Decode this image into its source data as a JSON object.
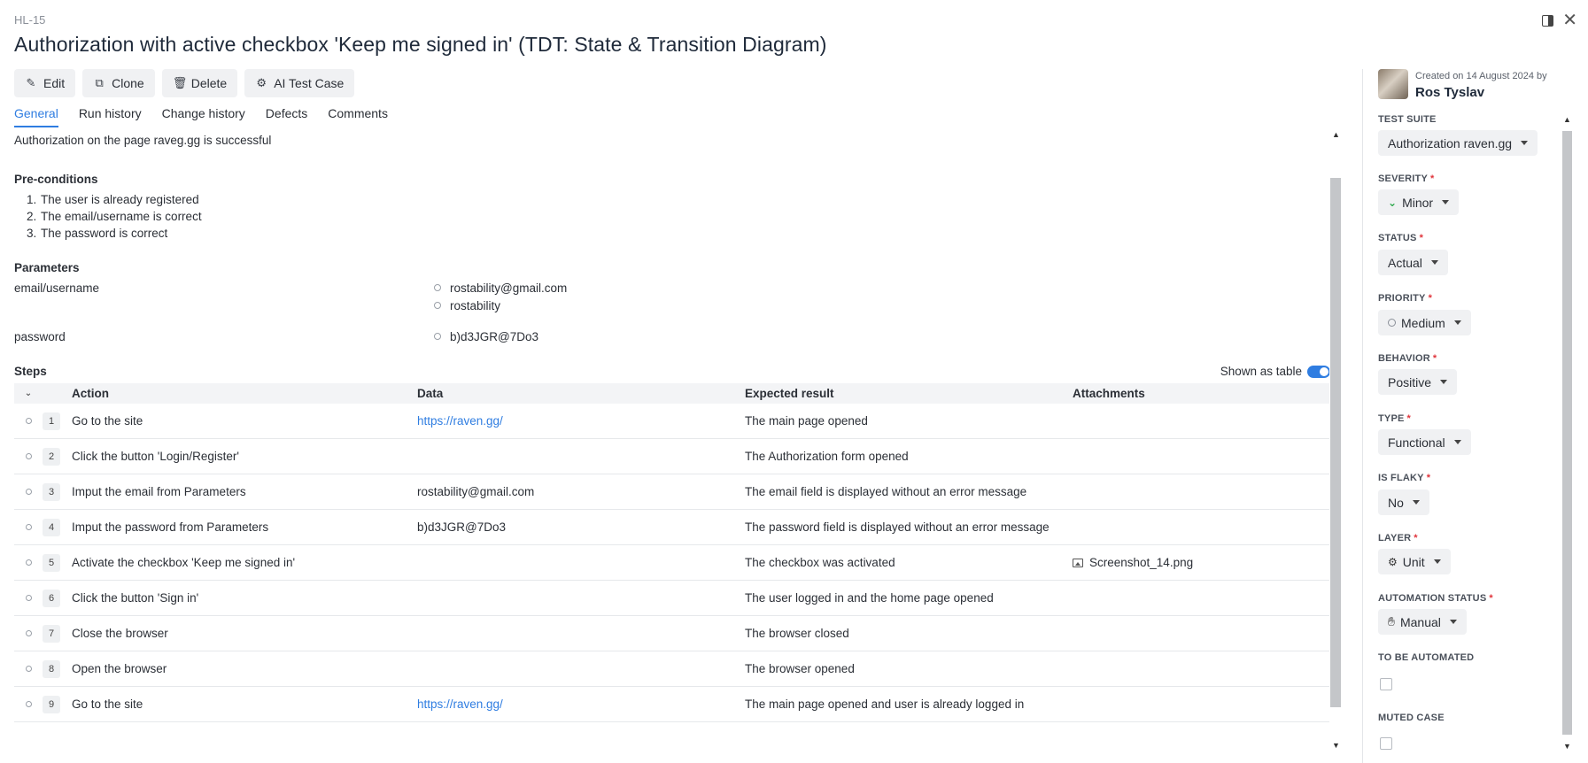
{
  "header": {
    "case_id": "HL-15",
    "title": "Authorization with active checkbox 'Keep me signed in' (TDT: State & Transition Diagram)"
  },
  "toolbar": {
    "edit": "Edit",
    "clone": "Clone",
    "delete": "Delete",
    "ai": "AI Test Case"
  },
  "tabs": [
    "General",
    "Run history",
    "Change history",
    "Defects",
    "Comments"
  ],
  "general": {
    "description": "Authorization on the page raveg.gg is successful",
    "preconditions_title": "Pre-conditions",
    "preconditions": [
      {
        "num": "1.",
        "text": "The user is already registered"
      },
      {
        "num": "2.",
        "text": "The email/username is correct"
      },
      {
        "num": "3.",
        "text": "The password is correct"
      }
    ],
    "parameters_title": "Parameters",
    "parameters": [
      {
        "name": "email/username",
        "values": [
          "rostability@gmail.com",
          "rostability"
        ]
      },
      {
        "name": "password",
        "values": [
          "b)d3JGR@7Do3"
        ]
      }
    ],
    "steps_title": "Steps",
    "shown_as_table": "Shown as table"
  },
  "steps_table": {
    "headers": {
      "action": "Action",
      "data": "Data",
      "expected": "Expected result",
      "attachments": "Attachments"
    },
    "rows": [
      {
        "num": "1",
        "action": "Go to the site",
        "data": "https://raven.gg/",
        "expected": "The main page opened",
        "attachment": ""
      },
      {
        "num": "2",
        "action": "Click the button 'Login/Register'",
        "data": "",
        "expected": "The Authorization form opened",
        "attachment": ""
      },
      {
        "num": "3",
        "action": "Imput the email from Parameters",
        "data": "rostability@gmail.com",
        "expected": "The email field is displayed without an error message",
        "attachment": ""
      },
      {
        "num": "4",
        "action": "Imput the password from Parameters",
        "data": "b)d3JGR@7Do3",
        "expected": "The password field is displayed without an error message",
        "attachment": ""
      },
      {
        "num": "5",
        "action": "Activate the checkbox 'Keep me signed in'",
        "data": "",
        "expected": "The checkbox was activated",
        "attachment": "Screenshot_14.png"
      },
      {
        "num": "6",
        "action": "Click the button 'Sign in'",
        "data": "",
        "expected": "The user logged in and the home page opened",
        "attachment": ""
      },
      {
        "num": "7",
        "action": "Close the browser",
        "data": "",
        "expected": "The browser closed",
        "attachment": ""
      },
      {
        "num": "8",
        "action": "Open the browser",
        "data": "",
        "expected": "The browser opened",
        "attachment": ""
      },
      {
        "num": "9",
        "action": "Go to the site",
        "data": "https://raven.gg/",
        "expected": "The main page opened and user is already logged in",
        "attachment": ""
      }
    ]
  },
  "sidebar": {
    "created": "Created on 14 August 2024 by",
    "author": "Ros Tyslav",
    "fields": {
      "test_suite": {
        "label": "TEST SUITE",
        "value": "Authorization raven.gg"
      },
      "severity": {
        "label": "SEVERITY",
        "value": "Minor"
      },
      "status": {
        "label": "STATUS",
        "value": "Actual"
      },
      "priority": {
        "label": "PRIORITY",
        "value": "Medium"
      },
      "behavior": {
        "label": "BEHAVIOR",
        "value": "Positive"
      },
      "type": {
        "label": "TYPE",
        "value": "Functional"
      },
      "is_flaky": {
        "label": "IS FLAKY",
        "value": "No"
      },
      "layer": {
        "label": "LAYER",
        "value": "Unit"
      },
      "automation_status": {
        "label": "AUTOMATION STATUS",
        "value": "Manual"
      },
      "to_be_automated": {
        "label": "TO BE AUTOMATED"
      },
      "muted_case": {
        "label": "MUTED CASE"
      }
    },
    "required_mark": "*"
  },
  "colors": {
    "accent": "#2f7de1",
    "required": "#e0343b",
    "severity_icon": "#2aa84a"
  }
}
